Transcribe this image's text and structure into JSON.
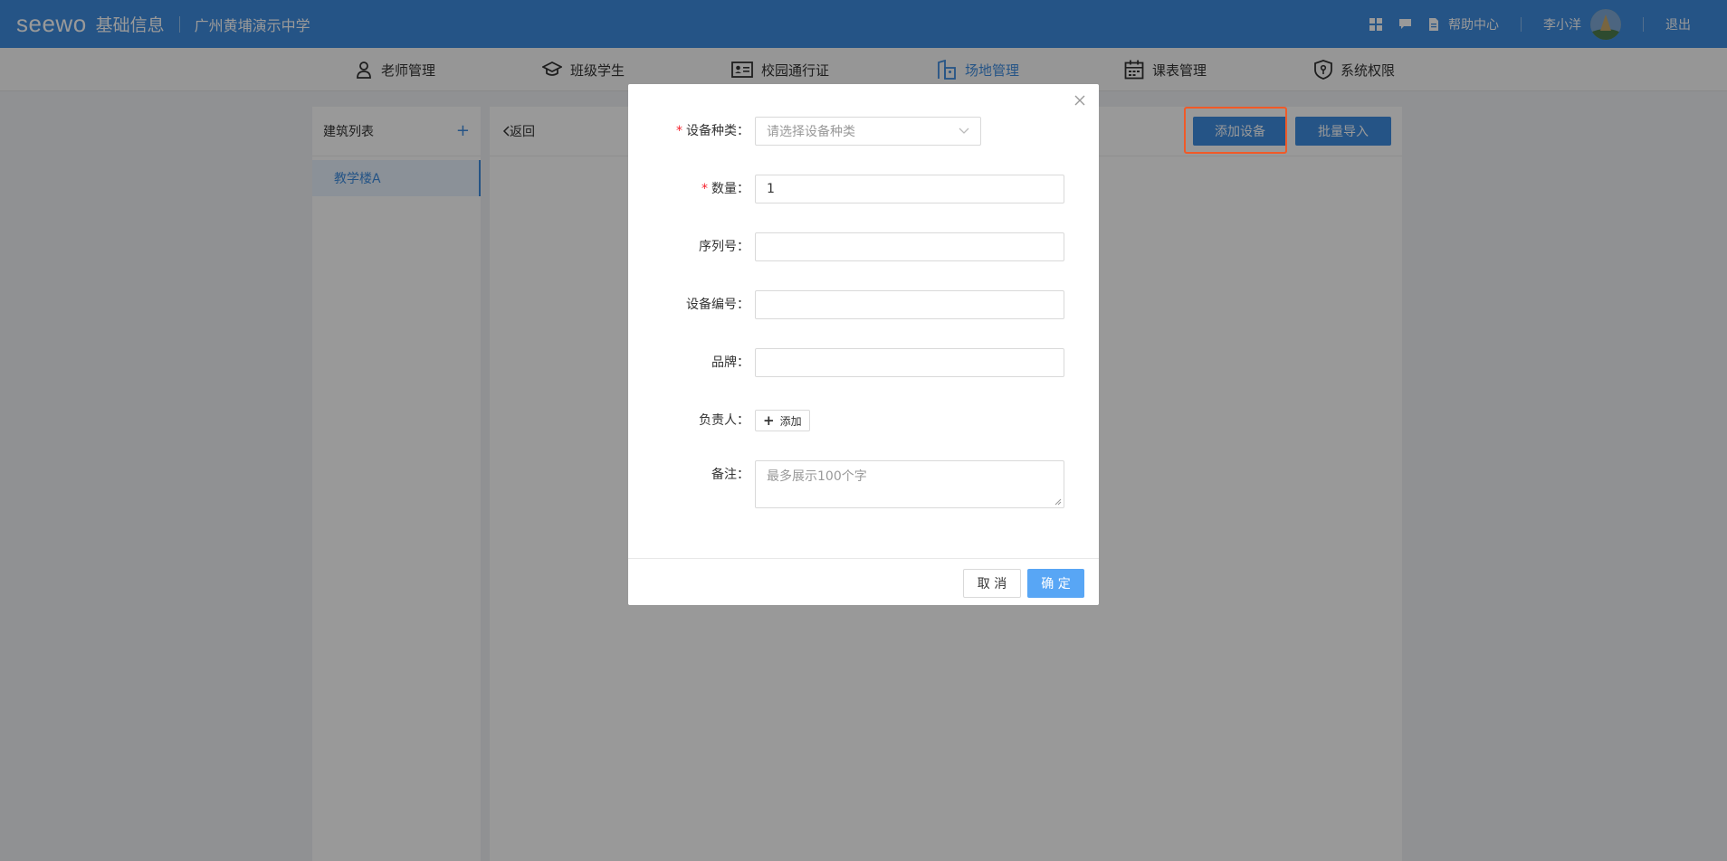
{
  "header": {
    "logo": "seewo",
    "title": "基础信息",
    "school": "广州黄埔演示中学",
    "help": "帮助中心",
    "user": "李小洋",
    "logout": "退出"
  },
  "nav": {
    "items": [
      {
        "label": "老师管理",
        "icon": "user-icon"
      },
      {
        "label": "班级学生",
        "icon": "graduation-cap-icon"
      },
      {
        "label": "校园通行证",
        "icon": "id-card-icon"
      },
      {
        "label": "场地管理",
        "icon": "building-icon",
        "active": true
      },
      {
        "label": "课表管理",
        "icon": "calendar-icon"
      },
      {
        "label": "系统权限",
        "icon": "shield-icon"
      }
    ]
  },
  "sidebar": {
    "title": "建筑列表",
    "add": "+",
    "items": [
      {
        "label": "教学楼A",
        "selected": true
      }
    ]
  },
  "main": {
    "back": "返回",
    "add_device": "添加设备",
    "batch_import": "批量导入"
  },
  "modal": {
    "device_type": {
      "label": "设备种类：",
      "placeholder": "请选择设备种类",
      "required": true
    },
    "quantity": {
      "label": "数量：",
      "value": "1",
      "required": true
    },
    "serial": {
      "label": "序列号：",
      "value": ""
    },
    "device_no": {
      "label": "设备编号：",
      "value": ""
    },
    "brand": {
      "label": "品牌：",
      "value": ""
    },
    "owner": {
      "label": "负责人：",
      "add": "添加"
    },
    "remark": {
      "label": "备注：",
      "placeholder": "最多展示100个字"
    },
    "cancel": "取 消",
    "confirm": "确 定"
  },
  "colors": {
    "primary": "#3f8de0",
    "confirm": "#58a6f5",
    "highlight": "#f05a28",
    "required": "#f5222d"
  }
}
